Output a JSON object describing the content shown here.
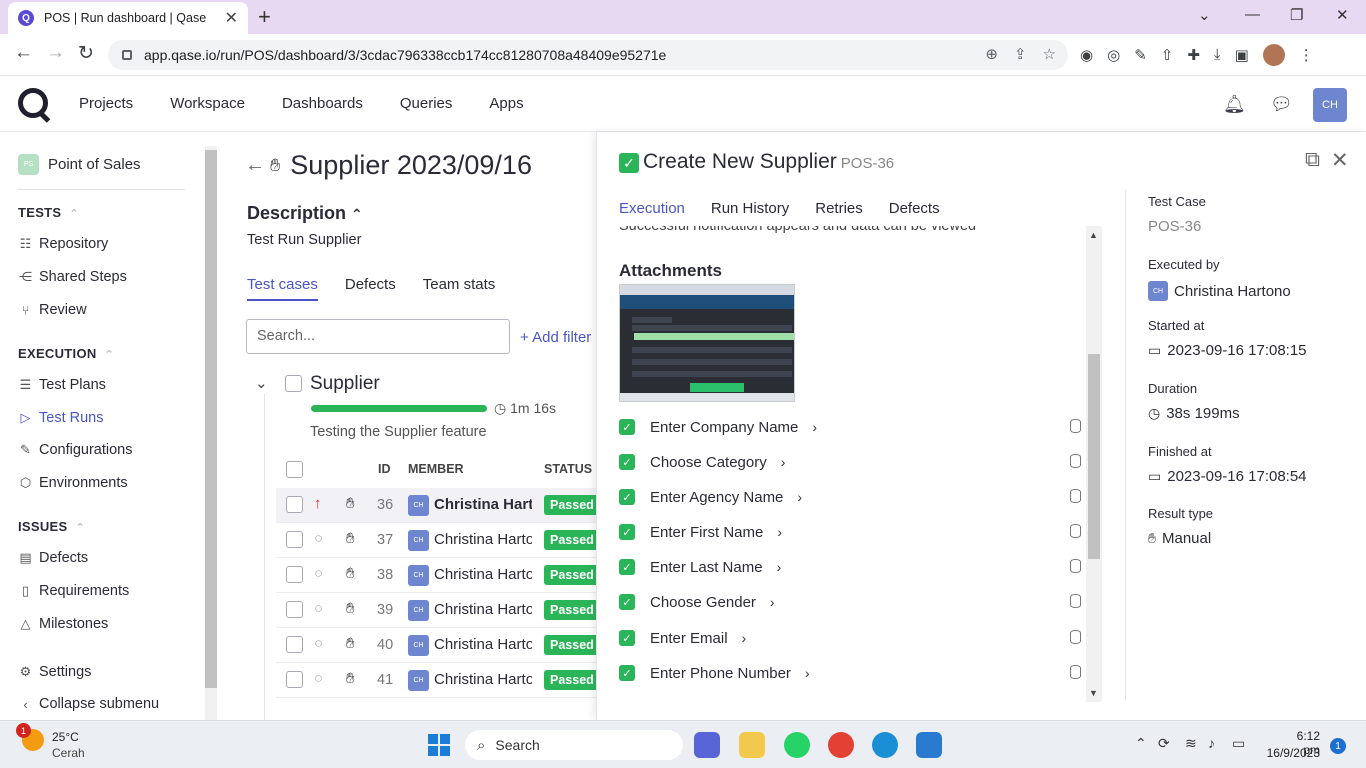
{
  "browser": {
    "tab_title": "POS | Run dashboard | Qase",
    "url": "app.qase.io/run/POS/dashboard/3/3cdac796338ccb174cc81280708a48409e95271e"
  },
  "header": {
    "nav": [
      "Projects",
      "Workspace",
      "Dashboards",
      "Queries",
      "Apps"
    ],
    "avatar_initials": "CH"
  },
  "sidebar": {
    "project_badge": "PS",
    "project_name": "Point of Sales",
    "sections": {
      "tests": "TESTS",
      "execution": "EXECUTION",
      "issues": "ISSUES"
    },
    "tests_items": [
      "Repository",
      "Shared Steps",
      "Review"
    ],
    "execution_items": [
      "Test Plans",
      "Test Runs",
      "Configurations",
      "Environments"
    ],
    "issues_items": [
      "Defects",
      "Requirements",
      "Milestones"
    ],
    "settings": "Settings",
    "collapse": "Collapse submenu"
  },
  "run": {
    "title": "Supplier 2023/09/16",
    "description_heading": "Description",
    "description": "Test Run Supplier",
    "tabs": [
      "Test cases",
      "Defects",
      "Team stats"
    ],
    "search_placeholder": "Search...",
    "add_filter": "+ Add filter",
    "suite": {
      "name": "Supplier",
      "duration": "1m 16s",
      "description": "Testing the Supplier feature",
      "progress": 1.0
    },
    "columns": {
      "id": "ID",
      "member": "MEMBER",
      "status": "STATUS"
    },
    "rows": [
      {
        "id": "36",
        "member": "Christina Hartono",
        "avatar": "CH",
        "status": "Passed"
      },
      {
        "id": "37",
        "member": "Christina Hartono",
        "avatar": "CH",
        "status": "Passed"
      },
      {
        "id": "38",
        "member": "Christina Hartono",
        "avatar": "CH",
        "status": "Passed"
      },
      {
        "id": "39",
        "member": "Christina Hartono",
        "avatar": "CH",
        "status": "Passed"
      },
      {
        "id": "40",
        "member": "Christina Hartono",
        "avatar": "CH",
        "status": "Passed"
      },
      {
        "id": "41",
        "member": "Christina Hartono",
        "avatar": "CH",
        "status": "Passed"
      }
    ]
  },
  "drawer": {
    "title": "Create New Supplier",
    "code": "POS-36",
    "tabs": [
      "Execution",
      "Run History",
      "Retries",
      "Defects"
    ],
    "cut_text": "Successful notification appears and data can be viewed",
    "attachments_heading": "Attachments",
    "steps": [
      "Enter Company Name",
      "Choose Category",
      "Enter Agency Name",
      "Enter First Name",
      "Enter Last Name",
      "Choose Gender",
      "Enter Email",
      "Enter Phone Number"
    ],
    "meta": {
      "test_case_label": "Test Case",
      "test_case": "POS-36",
      "executed_by_label": "Executed by",
      "executed_by_avatar": "CH",
      "executed_by": "Christina Hartono",
      "started_label": "Started at",
      "started": "2023-09-16 17:08:15",
      "duration_label": "Duration",
      "duration": "38s 199ms",
      "finished_label": "Finished at",
      "finished": "2023-09-16 17:08:54",
      "result_type_label": "Result type",
      "result_type": "Manual"
    }
  },
  "taskbar": {
    "weather_temp": "25°C",
    "weather_desc": "Cerah",
    "weather_badge": "1",
    "search": "Search",
    "time": "6:12 pm",
    "date": "16/9/2023",
    "notif_count": "1"
  },
  "colors": {
    "accent": "#4a55c8",
    "passed": "#2bb559",
    "avatar": "#6e86cf"
  }
}
